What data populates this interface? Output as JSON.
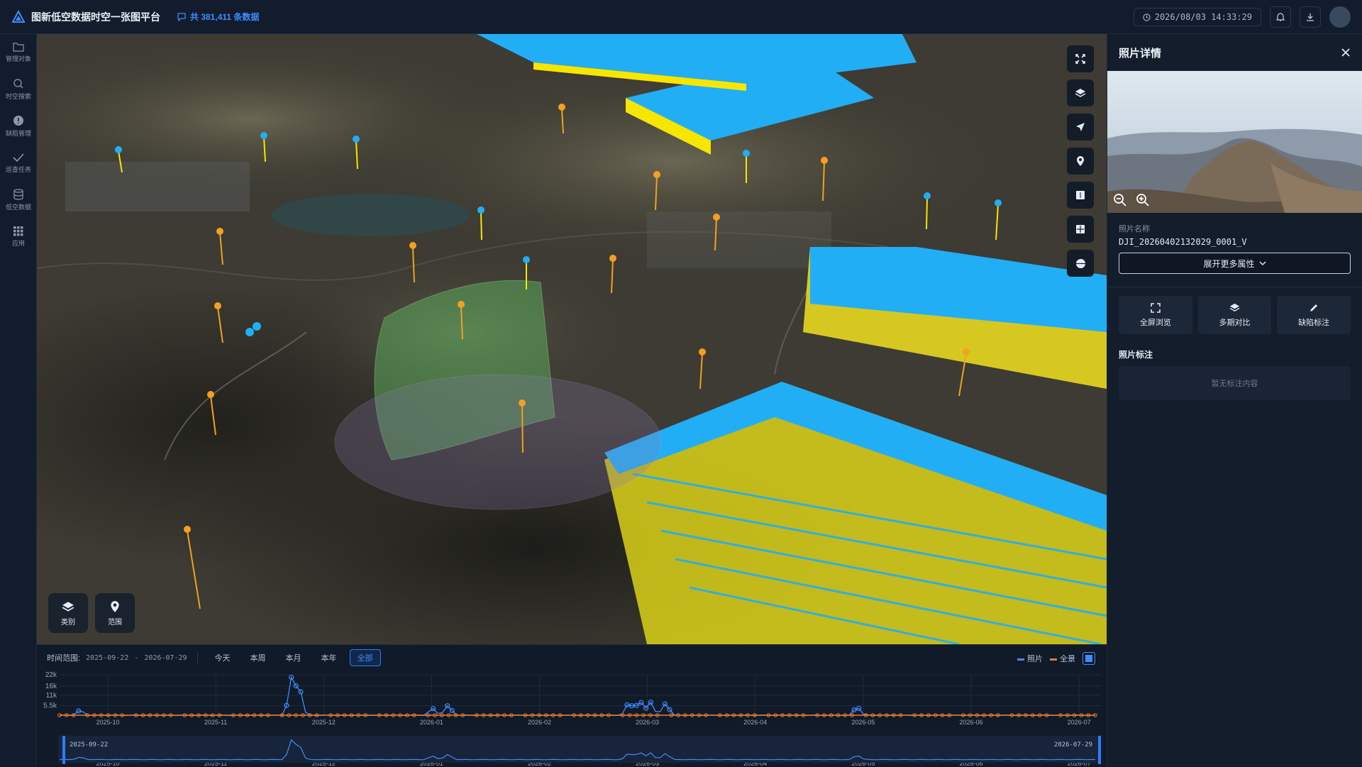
{
  "header": {
    "title": "图新低空数据时空一张图平台",
    "data_count": "共 381,411 条数据",
    "datetime": "2026/08/03 14:33:29"
  },
  "sidebar": {
    "items": [
      {
        "label": "管理对象",
        "icon": "folder-icon"
      },
      {
        "label": "时空搜索",
        "icon": "search-icon"
      },
      {
        "label": "缺陷管理",
        "icon": "alert-icon"
      },
      {
        "label": "巡查任务",
        "icon": "check-icon"
      },
      {
        "label": "低空数据",
        "icon": "database-icon"
      },
      {
        "label": "应用",
        "icon": "grid-icon"
      }
    ]
  },
  "map": {
    "tools": [
      "extent-icon",
      "layers-icon",
      "locate-icon",
      "pin-icon",
      "split-icon",
      "grid-icon",
      "globe-icon"
    ],
    "bottom_buttons": [
      {
        "label": "类别",
        "icon": "layers-icon"
      },
      {
        "label": "范围",
        "icon": "pin-icon"
      }
    ]
  },
  "timeline": {
    "label": "时间范围:",
    "start": "2025-09-22",
    "sep": "-",
    "end": "2026-07-29",
    "buttons": [
      "今天",
      "本周",
      "本月",
      "本年",
      "全部"
    ],
    "active": "全部",
    "legend": [
      {
        "label": "照片",
        "color": "#3f8cff"
      },
      {
        "label": "全景",
        "color": "#f07a2c"
      }
    ],
    "brush_start": "2025-09-22",
    "brush_end": "2026-07-29"
  },
  "chart_data": {
    "type": "line",
    "y_ticks": [
      "22k",
      "16k",
      "11k",
      "5.5k"
    ],
    "x_ticks": [
      "2025-10",
      "2025-11",
      "2025-12",
      "2026-01",
      "2026-02",
      "2026-03",
      "2026-04",
      "2026-05",
      "2026-06",
      "2026-07"
    ],
    "series": [
      {
        "name": "照片",
        "color": "#3f8cff",
        "peaks": [
          [
            0.02,
            3000
          ],
          [
            0.225,
            22000
          ],
          [
            0.23,
            18000
          ],
          [
            0.36,
            4000
          ],
          [
            0.375,
            5500
          ],
          [
            0.55,
            7000
          ],
          [
            0.56,
            8000
          ],
          [
            0.57,
            7500
          ],
          [
            0.585,
            6500
          ],
          [
            0.77,
            4500
          ]
        ]
      },
      {
        "name": "全景",
        "color": "#f07a2c",
        "peaks": []
      }
    ]
  },
  "panel": {
    "title": "照片详情",
    "name_label": "照片名称",
    "name_value": "DJI_20260402132029_0001_V",
    "expand_label": "展开更多属性",
    "actions": [
      {
        "label": "全屏浏览",
        "icon": "fullscreen-icon"
      },
      {
        "label": "多期对比",
        "icon": "layers-icon"
      },
      {
        "label": "缺陷标注",
        "icon": "pencil-icon"
      }
    ],
    "annot_title": "照片标注",
    "annot_empty": "暂无标注内容"
  }
}
